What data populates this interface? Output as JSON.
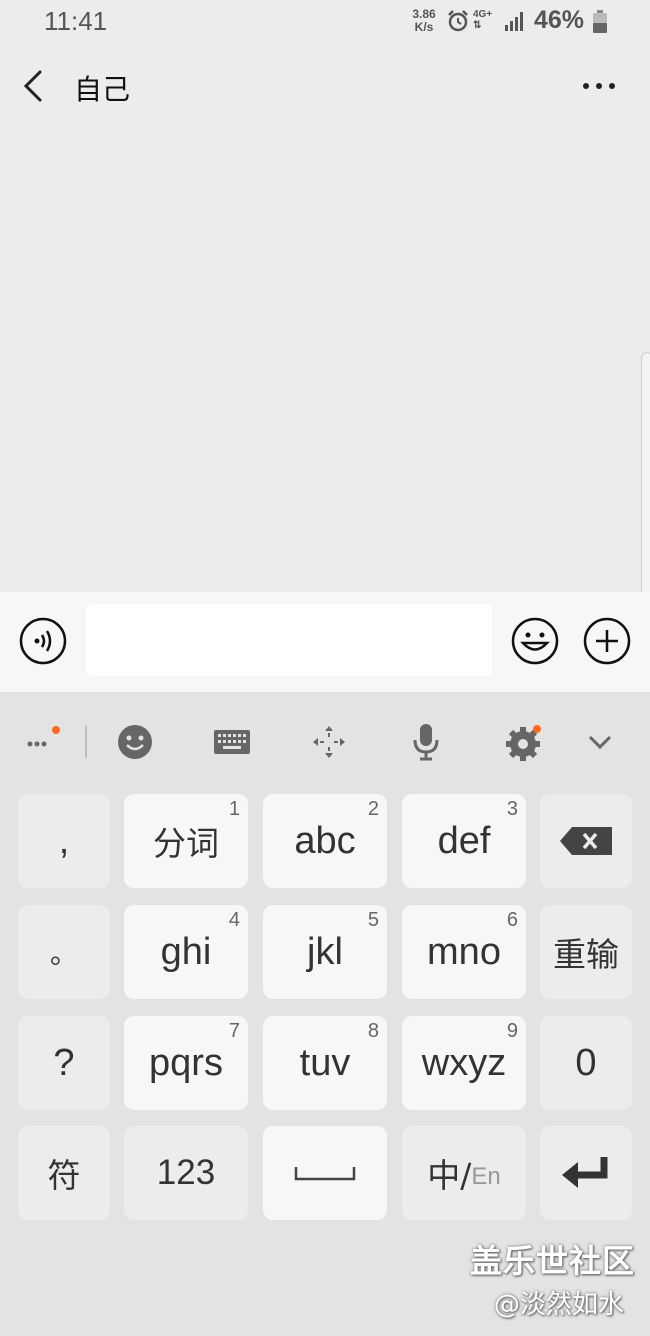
{
  "status_bar": {
    "time": "11:41",
    "net_speed_value": "3.86",
    "net_speed_unit": "K/s",
    "network_type": "4G+",
    "battery_percent": "46%"
  },
  "header": {
    "title": "自己"
  },
  "input_bar": {
    "text_value": ""
  },
  "keyboard": {
    "keys": {
      "comma": ",",
      "fenci": "分词",
      "fenci_num": "1",
      "abc": "abc",
      "abc_num": "2",
      "def": "def",
      "def_num": "3",
      "period": "。",
      "ghi": "ghi",
      "ghi_num": "4",
      "jkl": "jkl",
      "jkl_num": "5",
      "mno": "mno",
      "mno_num": "6",
      "reinput": "重输",
      "question": "?",
      "pqrs": "pqrs",
      "pqrs_num": "7",
      "tuv": "tuv",
      "tuv_num": "8",
      "wxyz": "wxyz",
      "wxyz_num": "9",
      "zero": "0",
      "symbol": "符",
      "num123": "123",
      "lang_cn": "中/",
      "lang_en": "En"
    }
  },
  "watermark": {
    "line1": "盖乐世社区",
    "line2": "@淡然如水"
  },
  "colors": {
    "notification_dot": "#ff6a1a",
    "icon_gray": "#555555"
  }
}
